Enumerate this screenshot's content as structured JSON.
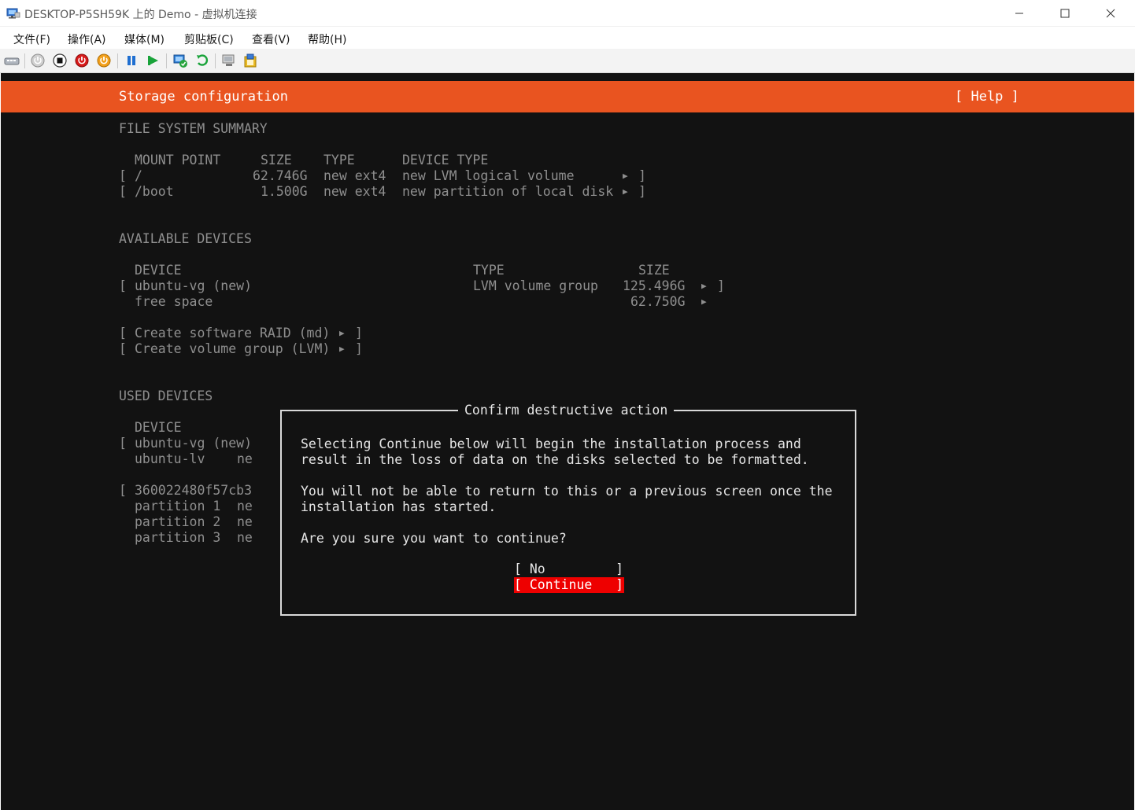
{
  "window": {
    "title": "DESKTOP-P5SH59K 上的 Demo - 虚拟机连接",
    "controls": [
      "minimize-icon",
      "maximize-icon",
      "close-icon"
    ]
  },
  "menu": {
    "items": [
      "文件(F)",
      "操作(A)",
      "媒体(M)",
      "剪贴板(C)",
      "查看(V)",
      "帮助(H)"
    ]
  },
  "toolbar": {
    "icons": [
      "ctrl-alt-del-icon",
      "start-icon",
      "turn-off-icon",
      "shutdown-icon",
      "power-button-icon",
      "pause-icon",
      "resume-icon",
      "checkpoint-icon",
      "revert-icon",
      "enhanced-session-icon",
      "share-icon"
    ]
  },
  "header": {
    "title": "Storage configuration",
    "help": "[ Help ]"
  },
  "fs_summary": {
    "heading": "FILE SYSTEM SUMMARY",
    "columns": [
      "MOUNT POINT",
      "SIZE",
      "TYPE",
      "DEVICE TYPE"
    ],
    "rows": [
      {
        "mount": "/",
        "size": "62.746G",
        "type": "new ext4",
        "device_type": "new LVM logical volume"
      },
      {
        "mount": "/boot",
        "size": "1.500G",
        "type": "new ext4",
        "device_type": "new partition of local disk"
      }
    ]
  },
  "available": {
    "heading": "AVAILABLE DEVICES",
    "columns": [
      "DEVICE",
      "TYPE",
      "SIZE"
    ],
    "rows": [
      {
        "device": "ubuntu-vg (new)",
        "type": "LVM volume group",
        "size": "125.496G"
      },
      {
        "device": "free space",
        "type": "",
        "size": "62.750G"
      }
    ],
    "actions": [
      "Create software RAID (md)",
      "Create volume group (LVM)"
    ]
  },
  "used": {
    "heading": "USED DEVICES",
    "column": "DEVICE",
    "rows": [
      {
        "device": "ubuntu-vg (new)",
        "bracket": true,
        "trail": ""
      },
      {
        "device": "ubuntu-lv",
        "bracket": false,
        "trail": "ne"
      },
      {
        "device": "360022480f57cb3",
        "bracket": true,
        "trail": ""
      },
      {
        "device": "partition 1",
        "bracket": false,
        "trail": "ne"
      },
      {
        "device": "partition 2",
        "bracket": false,
        "trail": "ne"
      },
      {
        "device": "partition 3",
        "bracket": false,
        "trail": "ne"
      }
    ]
  },
  "dialog": {
    "title": "Confirm destructive action",
    "para1_line1": "Selecting Continue below will begin the installation process and",
    "para1_line2": "result in the loss of data on the disks selected to be formatted.",
    "para2_line1": "You will not be able to return to this or a previous screen once the",
    "para2_line2": "installation has started.",
    "question": "Are you sure you want to continue?",
    "no_button": "[ No         ]",
    "continue_button": "[ Continue   ]"
  },
  "colors": {
    "header": "#e95420",
    "selected_button": "#ee0000",
    "console_bg": "#121212"
  }
}
